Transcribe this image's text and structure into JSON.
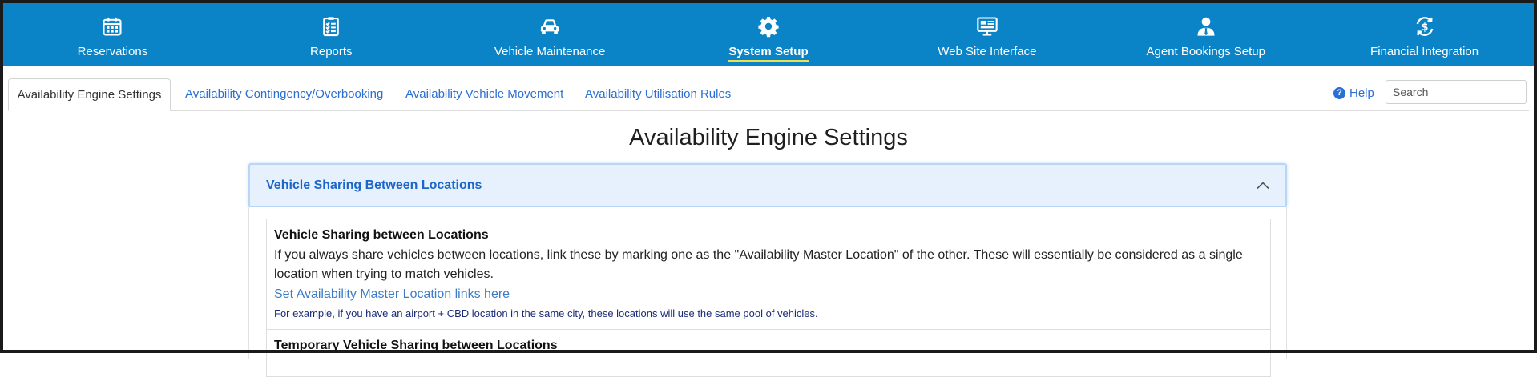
{
  "nav": {
    "items": [
      {
        "label": "Reservations",
        "icon": "calendar-icon",
        "active": false
      },
      {
        "label": "Reports",
        "icon": "clipboard-checklist-icon",
        "active": false
      },
      {
        "label": "Vehicle Maintenance",
        "icon": "car-icon",
        "active": false
      },
      {
        "label": "System Setup",
        "icon": "gear-icon",
        "active": true
      },
      {
        "label": "Web Site Interface",
        "icon": "monitor-icon",
        "active": false
      },
      {
        "label": "Agent Bookings Setup",
        "icon": "agent-user-icon",
        "active": false
      },
      {
        "label": "Financial Integration",
        "icon": "dollar-cycle-icon",
        "active": false
      }
    ],
    "colors": {
      "background": "#0a84c6",
      "active_underline": "#f2e04a"
    }
  },
  "tabs": [
    {
      "label": "Availability Engine Settings",
      "active": true
    },
    {
      "label": "Availability Contingency/Overbooking",
      "active": false
    },
    {
      "label": "Availability Vehicle Movement",
      "active": false
    },
    {
      "label": "Availability Utilisation Rules",
      "active": false
    }
  ],
  "help": {
    "label": "Help",
    "icon": "question-circle-icon"
  },
  "search": {
    "placeholder": "Search",
    "value": ""
  },
  "page": {
    "title": "Availability Engine Settings"
  },
  "accordion": {
    "title": "Vehicle Sharing Between Locations",
    "expanded": true,
    "icon": "chevron-up-icon",
    "panels": [
      {
        "heading": "Vehicle Sharing between Locations",
        "description": "If you always share vehicles between locations, link these by marking one as the \"Availability Master Location\" of the other. These will essentially be considered as a single location when trying to match vehicles.",
        "link": "Set Availability Master Location links here",
        "example": "For example, if you have an airport + CBD location in the same city, these locations will use the same pool of vehicles."
      },
      {
        "heading": "Temporary Vehicle Sharing between Locations"
      }
    ]
  }
}
